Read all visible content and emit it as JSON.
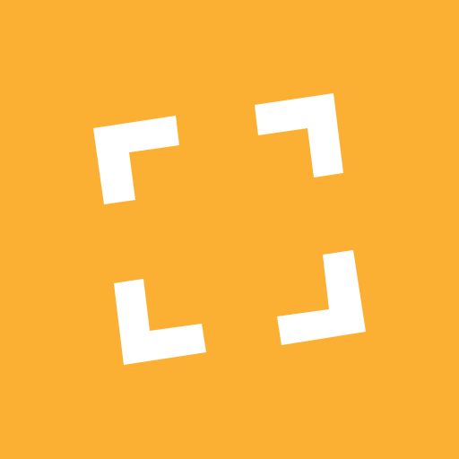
{
  "app_icon": {
    "icon": "fullscreen-frame-icon",
    "background_color": "#fbb034",
    "glyph_color": "#ffffff",
    "corners": [
      {
        "name": "top-left",
        "icon": "corner-top-left-icon"
      },
      {
        "name": "top-right",
        "icon": "corner-top-right-icon"
      },
      {
        "name": "bottom-left",
        "icon": "corner-bottom-left-icon"
      },
      {
        "name": "bottom-right",
        "icon": "corner-bottom-right-icon"
      }
    ]
  }
}
